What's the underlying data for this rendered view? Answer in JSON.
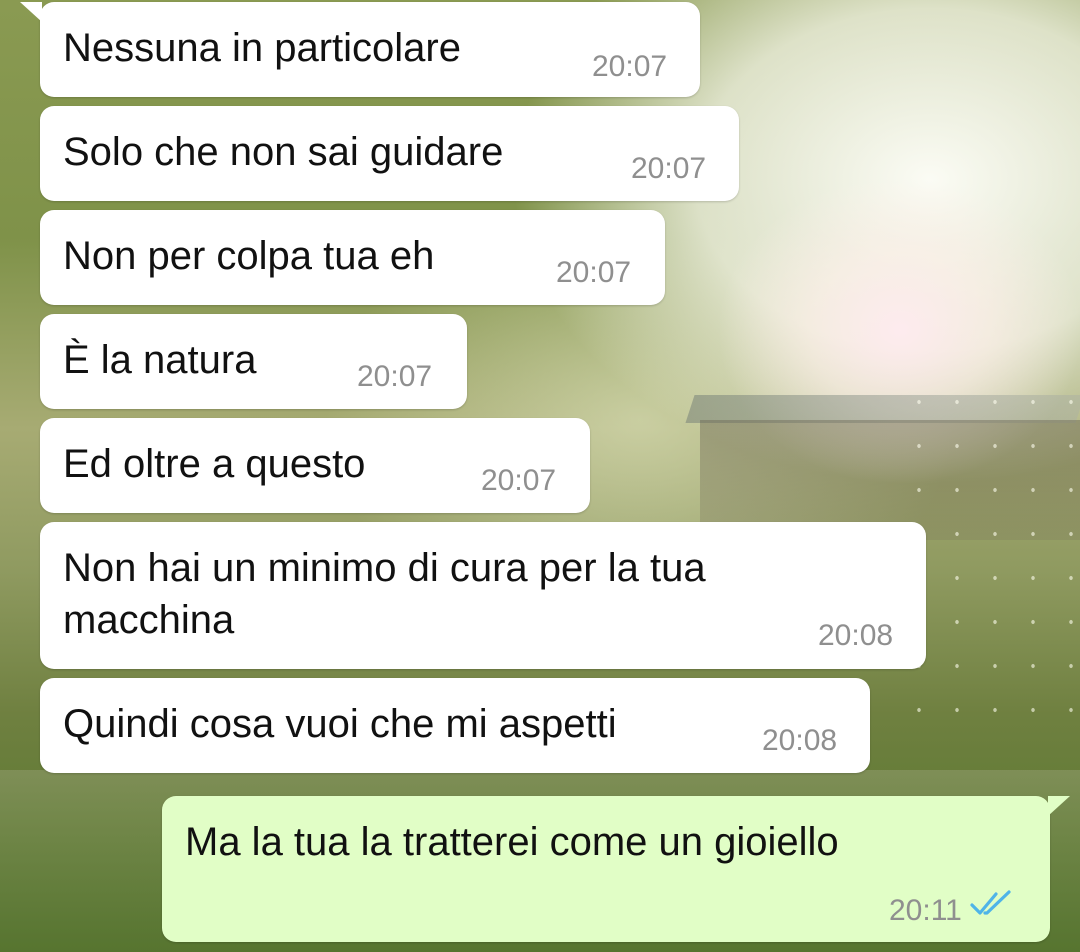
{
  "messages": [
    {
      "text": "Nessuna in particolare",
      "time": "20:07"
    },
    {
      "text": "Solo che non sai guidare",
      "time": "20:07"
    },
    {
      "text": "Non per colpa tua eh",
      "time": "20:07"
    },
    {
      "text": "È la natura",
      "time": "20:07"
    },
    {
      "text": "Ed oltre a questo",
      "time": "20:07"
    },
    {
      "text_line1": "Non hai un minimo di cura per la tua",
      "text_line2": "macchina",
      "time": "20:08"
    },
    {
      "text": "Quindi cosa vuoi che mi aspetti",
      "time": "20:08"
    },
    {
      "text": "Ma la tua la tratterei come un gioiello",
      "time": "20:11",
      "status": "read",
      "tick_color": "#4fb4e8"
    }
  ],
  "colors": {
    "incoming_bubble": "#ffffff",
    "outgoing_bubble": "#e1fec6",
    "timestamp": "#8f8f8f",
    "read_ticks": "#4fb4e8"
  },
  "icons": {
    "read_receipt": "double-check-icon"
  }
}
